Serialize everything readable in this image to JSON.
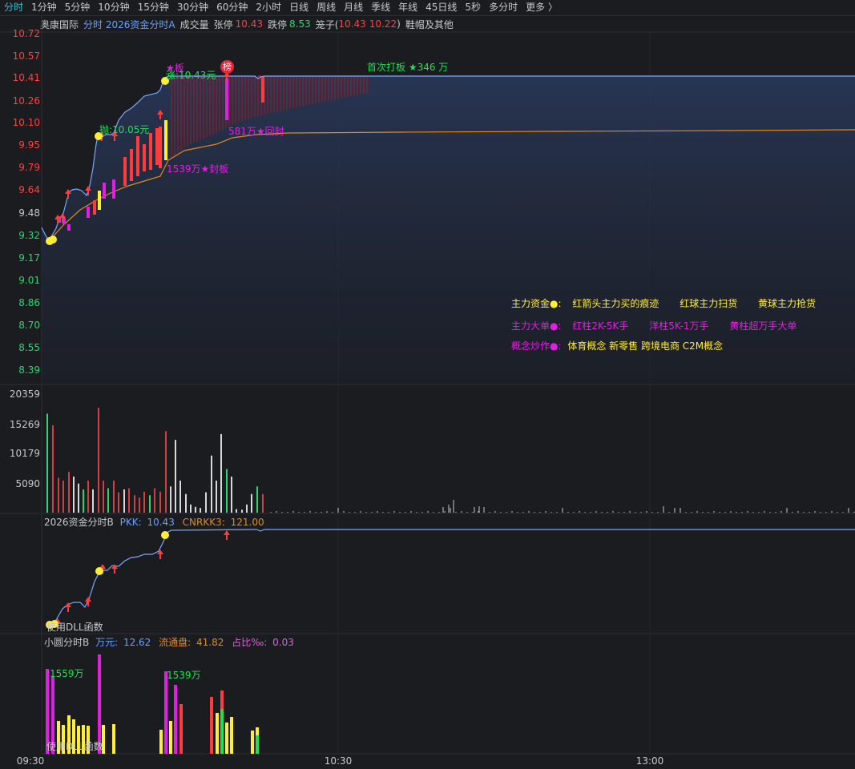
{
  "tabs": [
    "分时",
    "1分钟",
    "5分钟",
    "10分钟",
    "15分钟",
    "30分钟",
    "60分钟",
    "2小时",
    "日线",
    "周线",
    "月线",
    "季线",
    "年线",
    "45日线",
    "5秒",
    "多分时",
    "更多 〉"
  ],
  "stock": {
    "name": "奥康国际",
    "indicator": "分时 2026资金分时A",
    "volume_label": "成交量",
    "limit_up_label": "张停",
    "limit_up": "10.43",
    "limit_down_label": "跌停",
    "limit_down": "8.53",
    "cage_label": "笼子(",
    "cage_low": "10.43",
    "cage_high": "10.22",
    "cage_close": ")",
    "industry": "鞋帽及其他"
  },
  "price_axis": [
    "10.72",
    "10.57",
    "10.41",
    "10.26",
    "10.10",
    "9.95",
    "9.79",
    "9.64",
    "9.48",
    "9.32",
    "9.17",
    "9.01",
    "8.86",
    "8.70",
    "8.55",
    "8.39"
  ],
  "vol_axis": [
    "20359",
    "15269",
    "10179",
    "5090"
  ],
  "annotations": {
    "board": "★板",
    "price_high": "涨:10.43元",
    "price_mid": "抛:10.05元",
    "seal": "1539万★封板",
    "reseal": "581万★回封",
    "first_board": "首次打板 ★346   万",
    "rank_badge": "榜"
  },
  "legend": {
    "row1_title": "主力资金●:",
    "row1_items": [
      "红箭头主力买的痕迹",
      "红球主力扫货",
      "黄球主力抢货"
    ],
    "row2_title": "主力大单●:",
    "row2_items": [
      "红柱2K-5K手",
      "洋柱5K-1万手",
      "黄柱超万手大单"
    ],
    "row3_title": "概念炒作●:",
    "row3_items": "体育概念 新零售 跨境电商 C2M概念"
  },
  "panel_b": {
    "title": "2026资金分时B",
    "pkk_label": "PKK:",
    "pkk": "10.43",
    "cnrkk_label": "CNRKK3:",
    "cnrkk": "121.00",
    "dll": "使用DLL函数"
  },
  "panel_c": {
    "title": "小圆分时B",
    "wan_label": "万元:",
    "wan": "12.62",
    "float_label": "流通盘:",
    "float": "41.82",
    "ratio_label": "占比‰:",
    "ratio": "0.03",
    "bar1": "1559万",
    "bar2": "1539万",
    "dll": "使用DLL函数"
  },
  "time_axis": [
    "09:30",
    "10:30",
    "13:00"
  ],
  "colors": {
    "up": "#ff3b3b",
    "down": "#2bd66e",
    "magenta": "#e020e0",
    "yellow": "#ffee33",
    "line": "#7aa7ff",
    "avg": "#e08a20",
    "green": "#22dd55"
  },
  "chart_data": {
    "type": "line",
    "title": "",
    "series": [],
    "ylim": [
      8.39,
      10.72
    ],
    "limit_up": 10.43
  }
}
